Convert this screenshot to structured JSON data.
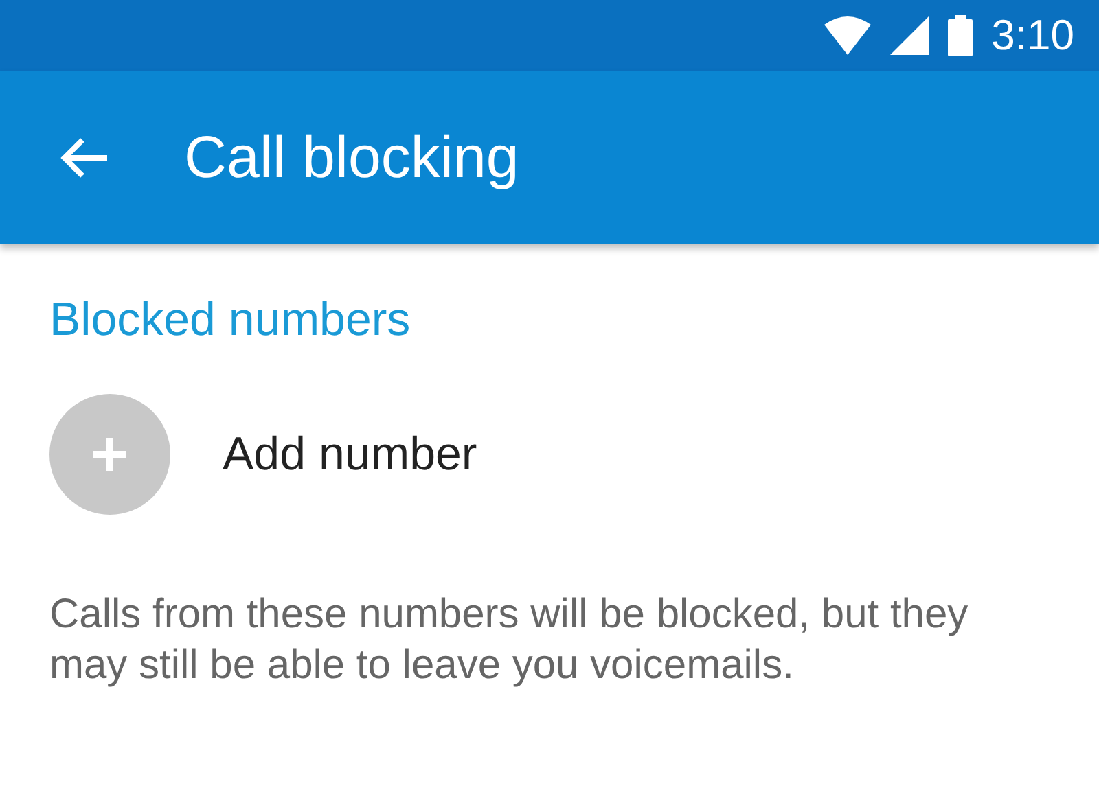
{
  "status_bar": {
    "time": "3:10"
  },
  "app_bar": {
    "title": "Call blocking"
  },
  "section": {
    "title": "Blocked numbers"
  },
  "add_row": {
    "label": "Add number"
  },
  "description": "Calls from these numbers will be blocked, but they may still be able to leave you voicemails."
}
